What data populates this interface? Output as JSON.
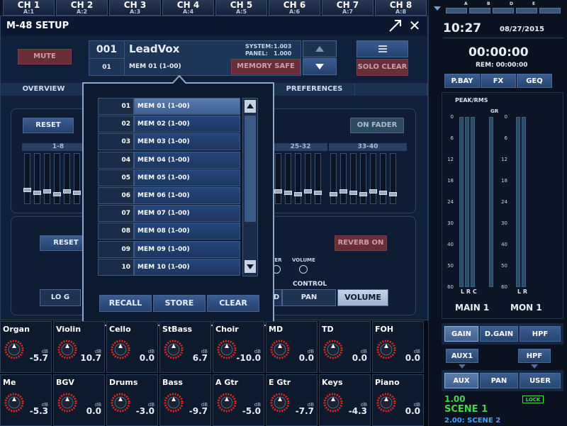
{
  "channels_top": [
    {
      "label": "CH 1",
      "sub": "A:1"
    },
    {
      "label": "CH 2",
      "sub": "A:2"
    },
    {
      "label": "CH 3",
      "sub": "A:3"
    },
    {
      "label": "CH 4",
      "sub": "A:4"
    },
    {
      "label": "CH 5",
      "sub": "A:5"
    },
    {
      "label": "CH 6",
      "sub": "A:6"
    },
    {
      "label": "CH 7",
      "sub": "A:7"
    },
    {
      "label": "CH 8",
      "sub": "A:8"
    }
  ],
  "window": {
    "title": "M-48 SETUP"
  },
  "buttons": {
    "mute": "MUTE",
    "memory_safe": "MEMORY SAFE",
    "solo_clear": "SOLO CLEAR",
    "reset": "RESET",
    "on_fader": "ON FADER",
    "reverb_on": "REVERB ON",
    "pan": "PAN",
    "volume": "VOLUME",
    "log": "LO G",
    "partial": "D",
    "recall": "RECALL",
    "store": "STORE",
    "clear": "CLEAR"
  },
  "memory": {
    "current_num": "001",
    "current_name": "LeadVox",
    "selected_num": "01",
    "selected_name": "MEM 01 (1-00)",
    "system_label": "SYSTEM:",
    "system_ver": "1.003",
    "panel_label": "PANEL:",
    "panel_ver": "1.000"
  },
  "tabs": {
    "overview": "OVERVIEW",
    "preferences": "PREFERENCES"
  },
  "groups": [
    "1-8",
    "25-32",
    "33-40"
  ],
  "control": {
    "section_label": "CONTROL",
    "iter": "ITER",
    "volume": "VOLUME"
  },
  "memory_list": [
    {
      "num": "01",
      "name": "MEM 01 (1-00)"
    },
    {
      "num": "02",
      "name": "MEM 02 (1-00)"
    },
    {
      "num": "03",
      "name": "MEM 03 (1-00)"
    },
    {
      "num": "04",
      "name": "MEM 04 (1-00)"
    },
    {
      "num": "05",
      "name": "MEM 05 (1-00)"
    },
    {
      "num": "06",
      "name": "MEM 06 (1-00)"
    },
    {
      "num": "07",
      "name": "MEM 07 (1-00)"
    },
    {
      "num": "08",
      "name": "MEM 08 (1-00)"
    },
    {
      "num": "09",
      "name": "MEM 09 (1-00)"
    },
    {
      "num": "10",
      "name": "MEM 10 (1-00)"
    }
  ],
  "knobs": [
    {
      "name": "Organ",
      "value": "-5.7"
    },
    {
      "name": "Violin",
      "value": "10.7"
    },
    {
      "name": "Cello",
      "value": "0.0"
    },
    {
      "name": "StBass",
      "value": "6.7"
    },
    {
      "name": "Choir",
      "value": "-10.0"
    },
    {
      "name": "MD",
      "value": "0.0"
    },
    {
      "name": "TD",
      "value": "0.0"
    },
    {
      "name": "FOH",
      "value": "0.0"
    },
    {
      "name": "Me",
      "value": "-5.3"
    },
    {
      "name": "BGV",
      "value": "0.0"
    },
    {
      "name": "Drums",
      "value": "-3.0"
    },
    {
      "name": "Bass",
      "value": "-9.7"
    },
    {
      "name": "A Gtr",
      "value": "-5.0"
    },
    {
      "name": "E Gtr",
      "value": "-7.7"
    },
    {
      "name": "Keys",
      "value": "-4.3"
    },
    {
      "name": "Piano",
      "value": "0.0"
    }
  ],
  "db_unit": "dB",
  "right": {
    "snake_labels": [
      "A",
      "B",
      "D",
      "E"
    ],
    "time": "10:27",
    "date": "08/27/2015",
    "timer": "00:00:00",
    "rem": "REM: 00:00:00",
    "nav": [
      "P.BAY",
      "FX",
      "GEQ"
    ],
    "peak_rms": "PEAK/RMS",
    "gr": "GR",
    "scale": [
      "0",
      "6",
      "12",
      "18",
      "24",
      "30",
      "40",
      "50",
      "60"
    ],
    "main_lrc": "L R C",
    "mon_lr": "L R",
    "main": "MAIN 1",
    "mon": "MON 1",
    "gain_row": [
      "GAIN",
      "D.GAIN",
      "HPF"
    ],
    "aux1": "AUX1",
    "hpf": "HPF",
    "aux_row": [
      "AUX",
      "PAN",
      "USER"
    ],
    "scene_num": "1.00",
    "lock": "LOCK",
    "scene_name": "SCENE 1",
    "next_scene": "2.00: SCENE 2"
  },
  "colors": {
    "accent": "#3b5e94",
    "maroon": "#6a2e38",
    "scene_green": "#3fd84a",
    "knob_red": "#e0281e"
  }
}
